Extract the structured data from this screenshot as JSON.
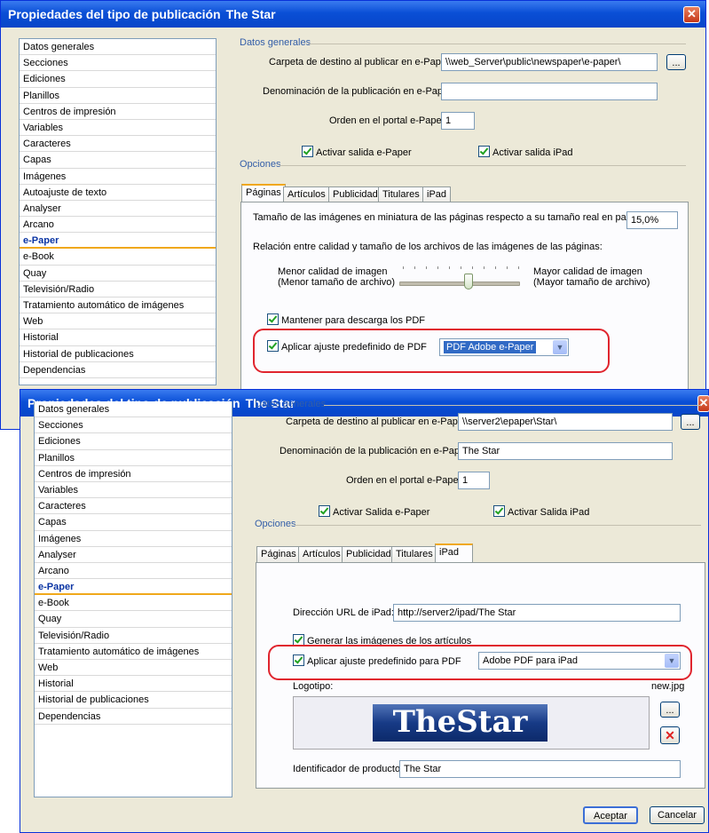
{
  "dialog1": {
    "title": "Propiedades del tipo de publicación",
    "app": "The Star",
    "close": "✕",
    "sidebar": [
      "Datos generales",
      "Secciones",
      "Ediciones",
      "Planillos",
      "Centros de impresión",
      "Variables",
      "Caracteres",
      "Capas",
      "Imágenes",
      "Autoajuste de texto",
      "Analyser",
      "Arcano",
      "e-Paper",
      "e-Book",
      "Quay",
      "Televisión/Radio",
      "Tratamiento automático de imágenes",
      "Web",
      "Historial",
      "Historial de publicaciones",
      "Dependencias"
    ],
    "selected": "e-Paper",
    "general": {
      "group": "Datos generales",
      "dest_label": "Carpeta de destino al publicar en e-Paper:",
      "dest_value": "\\\\web_Server\\public\\newspaper\\e-paper\\",
      "browse": "...",
      "name_label": "Denominación de la publicación en e-Paper:",
      "name_value": "",
      "order_label": "Orden en el portal e-Paper:",
      "order_value": "1",
      "check1": "Activar salida e-Paper",
      "check2": "Activar salida iPad"
    },
    "options_group": "Opciones",
    "tabs": [
      "Páginas",
      "Artículos",
      "Publicidad",
      "Titulares",
      "iPad"
    ],
    "active_tab": "Páginas",
    "pages": {
      "thumb_label": "Tamaño de las imágenes en miniatura de las páginas respecto a su tamaño real en papel:",
      "thumb_value": "15,0%",
      "ratio_label": "Relación entre calidad y tamaño de los archivos de las imágenes de las páginas:",
      "min_label1": "Menor calidad de imagen",
      "min_label2": "(Menor tamaño de archivo)",
      "max_label1": "Mayor calidad de imagen",
      "max_label2": "(Mayor tamaño de archivo)",
      "slider_level": 0.6,
      "keep_pdf": "Mantener para descarga los PDF",
      "apply_pdf": "Aplicar ajuste predefinido de PDF",
      "pdf_preset": "PDF Adobe e-Paper"
    }
  },
  "dialog2": {
    "title": "Propiedades del tipo de publicación",
    "app": "The Star",
    "close": "✕",
    "sidebar": [
      "Datos generales",
      "Secciones",
      "Ediciones",
      "Planillos",
      "Centros de impresión",
      "Variables",
      "Caracteres",
      "Capas",
      "Imágenes",
      "Analyser",
      "Arcano",
      "e-Paper",
      "e-Book",
      "Quay",
      "Televisión/Radio",
      "Tratamiento automático de imágenes",
      "Web",
      "Historial",
      "Historial de publicaciones",
      "Dependencias"
    ],
    "selected": "e-Paper",
    "general": {
      "group": "Datos generales",
      "dest_label": "Carpeta de destino al publicar en e-Paper:",
      "dest_value": "\\\\server2\\epaper\\Star\\",
      "browse": "...",
      "name_label": "Denominación de la publicación en e-Paper:",
      "name_value": "The Star",
      "order_label": "Orden en el portal e-Paper:",
      "order_value": "1",
      "check1": "Activar Salida e-Paper",
      "check2": "Activar Salida iPad"
    },
    "options_group": "Opciones",
    "tabs": [
      "Páginas",
      "Artículos",
      "Publicidad",
      "Titulares",
      "iPad"
    ],
    "active_tab": "iPad",
    "ipad": {
      "url_label": "Dirección URL de iPad:",
      "url_value": "http://server2/ipad/The Star",
      "gen_images": "Generar las imágenes de los artículos",
      "apply_pdf": "Aplicar ajuste predefinido para PDF",
      "pdf_preset": "Adobe PDF para iPad",
      "logo_label": "Logotipo:",
      "logo_file": "new.jpg",
      "logo_text": "TheStar",
      "browse": "...",
      "delete": "✕",
      "product_label": "Identificador de producto:",
      "product_value": "The Star"
    },
    "ok": "Aceptar",
    "cancel": "Cancelar"
  },
  "colors": {
    "highlight": "#e0252e",
    "title_bar": "#0a4fd6",
    "selection": "#f0a81b"
  }
}
